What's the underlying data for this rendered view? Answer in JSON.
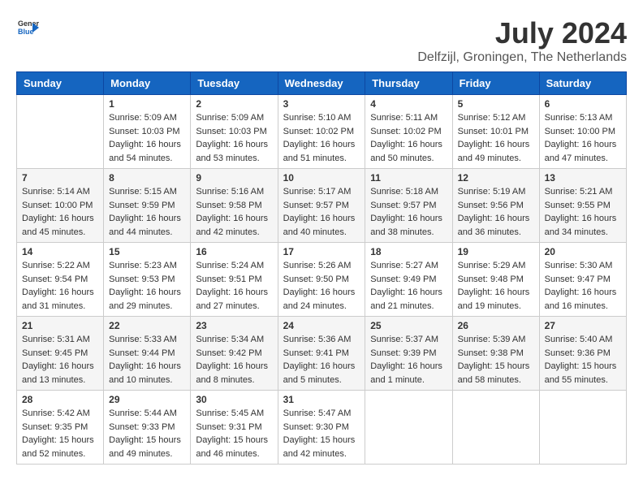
{
  "header": {
    "logo_general": "General",
    "logo_blue": "Blue",
    "month_year": "July 2024",
    "location": "Delfzijl, Groningen, The Netherlands"
  },
  "weekdays": [
    "Sunday",
    "Monday",
    "Tuesday",
    "Wednesday",
    "Thursday",
    "Friday",
    "Saturday"
  ],
  "weeks": [
    [
      {
        "day": "",
        "info": ""
      },
      {
        "day": "1",
        "info": "Sunrise: 5:09 AM\nSunset: 10:03 PM\nDaylight: 16 hours\nand 54 minutes."
      },
      {
        "day": "2",
        "info": "Sunrise: 5:09 AM\nSunset: 10:03 PM\nDaylight: 16 hours\nand 53 minutes."
      },
      {
        "day": "3",
        "info": "Sunrise: 5:10 AM\nSunset: 10:02 PM\nDaylight: 16 hours\nand 51 minutes."
      },
      {
        "day": "4",
        "info": "Sunrise: 5:11 AM\nSunset: 10:02 PM\nDaylight: 16 hours\nand 50 minutes."
      },
      {
        "day": "5",
        "info": "Sunrise: 5:12 AM\nSunset: 10:01 PM\nDaylight: 16 hours\nand 49 minutes."
      },
      {
        "day": "6",
        "info": "Sunrise: 5:13 AM\nSunset: 10:00 PM\nDaylight: 16 hours\nand 47 minutes."
      }
    ],
    [
      {
        "day": "7",
        "info": "Sunrise: 5:14 AM\nSunset: 10:00 PM\nDaylight: 16 hours\nand 45 minutes."
      },
      {
        "day": "8",
        "info": "Sunrise: 5:15 AM\nSunset: 9:59 PM\nDaylight: 16 hours\nand 44 minutes."
      },
      {
        "day": "9",
        "info": "Sunrise: 5:16 AM\nSunset: 9:58 PM\nDaylight: 16 hours\nand 42 minutes."
      },
      {
        "day": "10",
        "info": "Sunrise: 5:17 AM\nSunset: 9:57 PM\nDaylight: 16 hours\nand 40 minutes."
      },
      {
        "day": "11",
        "info": "Sunrise: 5:18 AM\nSunset: 9:57 PM\nDaylight: 16 hours\nand 38 minutes."
      },
      {
        "day": "12",
        "info": "Sunrise: 5:19 AM\nSunset: 9:56 PM\nDaylight: 16 hours\nand 36 minutes."
      },
      {
        "day": "13",
        "info": "Sunrise: 5:21 AM\nSunset: 9:55 PM\nDaylight: 16 hours\nand 34 minutes."
      }
    ],
    [
      {
        "day": "14",
        "info": "Sunrise: 5:22 AM\nSunset: 9:54 PM\nDaylight: 16 hours\nand 31 minutes."
      },
      {
        "day": "15",
        "info": "Sunrise: 5:23 AM\nSunset: 9:53 PM\nDaylight: 16 hours\nand 29 minutes."
      },
      {
        "day": "16",
        "info": "Sunrise: 5:24 AM\nSunset: 9:51 PM\nDaylight: 16 hours\nand 27 minutes."
      },
      {
        "day": "17",
        "info": "Sunrise: 5:26 AM\nSunset: 9:50 PM\nDaylight: 16 hours\nand 24 minutes."
      },
      {
        "day": "18",
        "info": "Sunrise: 5:27 AM\nSunset: 9:49 PM\nDaylight: 16 hours\nand 21 minutes."
      },
      {
        "day": "19",
        "info": "Sunrise: 5:29 AM\nSunset: 9:48 PM\nDaylight: 16 hours\nand 19 minutes."
      },
      {
        "day": "20",
        "info": "Sunrise: 5:30 AM\nSunset: 9:47 PM\nDaylight: 16 hours\nand 16 minutes."
      }
    ],
    [
      {
        "day": "21",
        "info": "Sunrise: 5:31 AM\nSunset: 9:45 PM\nDaylight: 16 hours\nand 13 minutes."
      },
      {
        "day": "22",
        "info": "Sunrise: 5:33 AM\nSunset: 9:44 PM\nDaylight: 16 hours\nand 10 minutes."
      },
      {
        "day": "23",
        "info": "Sunrise: 5:34 AM\nSunset: 9:42 PM\nDaylight: 16 hours\nand 8 minutes."
      },
      {
        "day": "24",
        "info": "Sunrise: 5:36 AM\nSunset: 9:41 PM\nDaylight: 16 hours\nand 5 minutes."
      },
      {
        "day": "25",
        "info": "Sunrise: 5:37 AM\nSunset: 9:39 PM\nDaylight: 16 hours\nand 1 minute."
      },
      {
        "day": "26",
        "info": "Sunrise: 5:39 AM\nSunset: 9:38 PM\nDaylight: 15 hours\nand 58 minutes."
      },
      {
        "day": "27",
        "info": "Sunrise: 5:40 AM\nSunset: 9:36 PM\nDaylight: 15 hours\nand 55 minutes."
      }
    ],
    [
      {
        "day": "28",
        "info": "Sunrise: 5:42 AM\nSunset: 9:35 PM\nDaylight: 15 hours\nand 52 minutes."
      },
      {
        "day": "29",
        "info": "Sunrise: 5:44 AM\nSunset: 9:33 PM\nDaylight: 15 hours\nand 49 minutes."
      },
      {
        "day": "30",
        "info": "Sunrise: 5:45 AM\nSunset: 9:31 PM\nDaylight: 15 hours\nand 46 minutes."
      },
      {
        "day": "31",
        "info": "Sunrise: 5:47 AM\nSunset: 9:30 PM\nDaylight: 15 hours\nand 42 minutes."
      },
      {
        "day": "",
        "info": ""
      },
      {
        "day": "",
        "info": ""
      },
      {
        "day": "",
        "info": ""
      }
    ]
  ]
}
